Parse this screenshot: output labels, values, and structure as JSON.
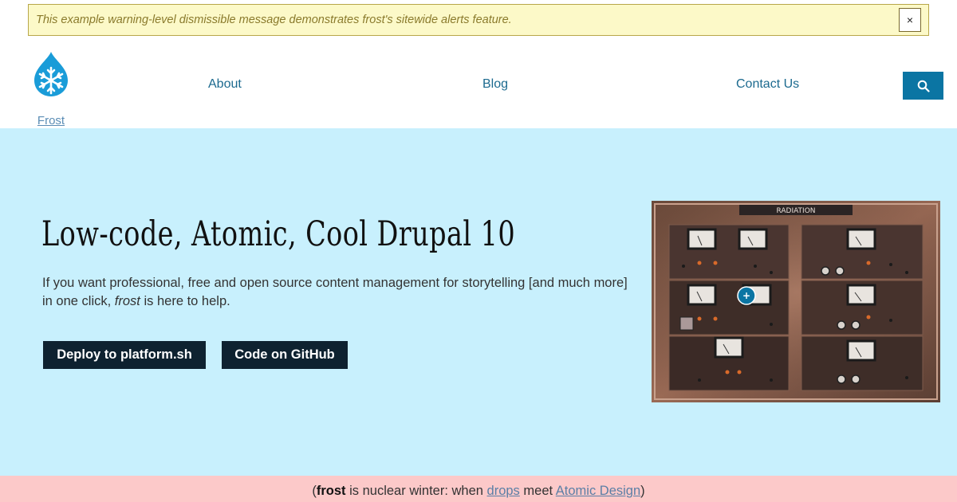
{
  "alert": {
    "message": "This example warning-level dismissible message demonstrates frost's sitewide alerts feature.",
    "close_label": "×"
  },
  "header": {
    "logo_label": "Frost",
    "nav": [
      {
        "label": "About"
      },
      {
        "label": "Blog"
      },
      {
        "label": "Contact Us"
      }
    ]
  },
  "hero": {
    "title": "Low-code, Atomic, Cool Drupal 10",
    "subtitle_before": "If you want professional, free and open source content management for storytelling [and much more] in one click, ",
    "subtitle_emph": "frost",
    "subtitle_after": " is here to help.",
    "buttons": [
      {
        "label": "Deploy to platform.sh"
      },
      {
        "label": "Code on GitHub"
      }
    ],
    "image_sign": "RADIATION"
  },
  "footer": {
    "open_paren": "(",
    "brand": "frost",
    "text_1": " is nuclear winter: when ",
    "link_1": "drops",
    "text_2": " meet ",
    "link_2": "Atomic Design",
    "close_paren": ")"
  },
  "colors": {
    "alert_bg": "#fcf9c8",
    "hero_bg": "#c8f0fd",
    "footer_bg": "#fcc9c9",
    "accent": "#0b75a3",
    "button_bg": "#0e2230"
  }
}
